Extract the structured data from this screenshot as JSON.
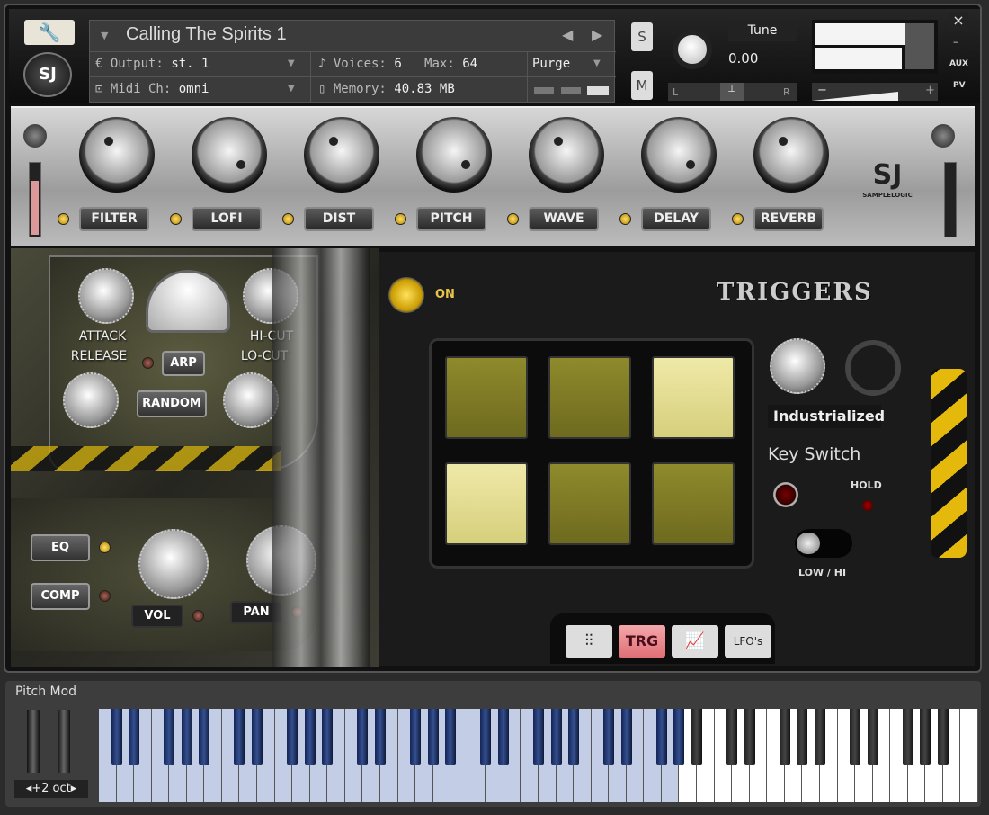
{
  "header": {
    "instrument_name": "Calling The Spirits 1",
    "output_label": "Output:",
    "output_value": "st. 1",
    "midi_label": "Midi Ch:",
    "midi_value": "omni",
    "voices_label": "Voices:",
    "voices_value": "6",
    "max_label": "Max:",
    "max_value": "64",
    "memory_label": "Memory:",
    "memory_value": "40.83 MB",
    "purge_label": "Purge",
    "solo": "S",
    "mute": "M",
    "tune_label": "Tune",
    "tune_value": "0.00",
    "pan_left": "L",
    "pan_right": "R",
    "vol_minus": "−",
    "vol_plus": "+",
    "close": "×",
    "minimize": "–",
    "aux": "AUX",
    "pv": "PV"
  },
  "fx": {
    "items": [
      {
        "label": "FILTER"
      },
      {
        "label": "LOFI"
      },
      {
        "label": "DIST"
      },
      {
        "label": "PITCH"
      },
      {
        "label": "WAVE"
      },
      {
        "label": "DELAY"
      },
      {
        "label": "REVERB"
      }
    ],
    "brand": "SAMPLELOGIC"
  },
  "left": {
    "attack_release": [
      "ATTACK",
      "RELEASE"
    ],
    "hicut_locut": [
      "HI-CUT",
      "LO-CUT"
    ],
    "arp": "ARP",
    "random": "RANDOM",
    "eq": "EQ",
    "comp": "COMP",
    "vol": "VOL",
    "pan": "PAN"
  },
  "triggers": {
    "title": "TRIGGERS",
    "on_label": "ON",
    "pads": [
      {
        "active": false
      },
      {
        "active": false
      },
      {
        "active": true
      },
      {
        "active": true
      },
      {
        "active": false
      },
      {
        "active": false
      }
    ],
    "preset": "Industrialized",
    "keyswitch_title": "Key Switch",
    "hold": "HOLD",
    "low_hi": "LOW / HI"
  },
  "tabs": [
    {
      "label": "mixer-icon",
      "text": ""
    },
    {
      "label": "TRG",
      "text": "TRG",
      "active": true
    },
    {
      "label": "graph-icon",
      "text": ""
    },
    {
      "label": "LFO's",
      "text": "LFO's"
    }
  ],
  "keyboard": {
    "pitch_mod": "Pitch Mod",
    "octave": "+2 oct",
    "white_keys": 50,
    "highlighted_white_keys": 33
  },
  "colors": {
    "accent_led": "#ffd84a",
    "pad_on": "#e8e29a",
    "pad_off": "#7e7a26",
    "trg_tab": "#e77a80",
    "hazard": "#e5b90c",
    "key_highlight": "#c3cde6"
  }
}
